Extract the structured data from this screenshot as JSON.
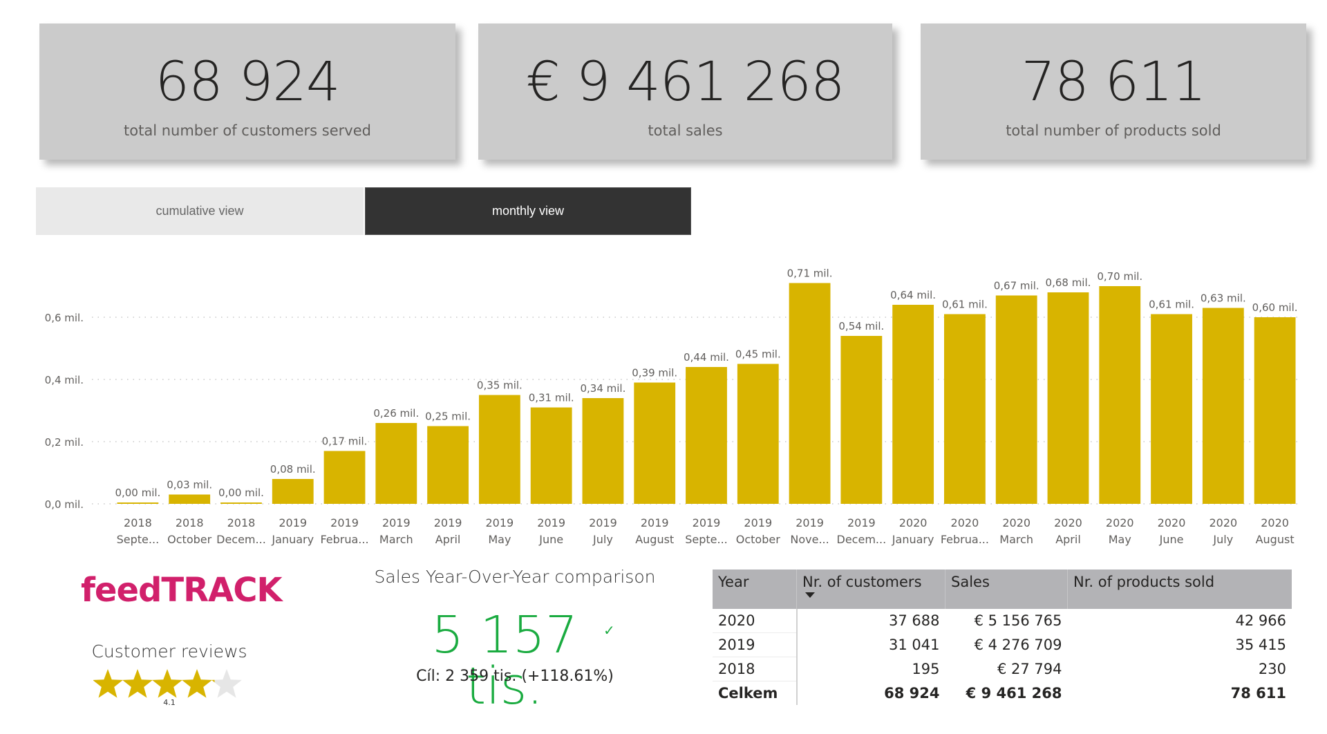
{
  "cards": [
    {
      "value": "68 924",
      "label": "total number of customers served"
    },
    {
      "value": "€ 9 461 268",
      "label": "total sales"
    },
    {
      "value": "78 611",
      "label": "total number of products sold"
    }
  ],
  "tabs": {
    "cumulative": "cumulative view",
    "monthly": "monthly view",
    "active": "monthly"
  },
  "colors": {
    "bar": "#d8b400",
    "kpi_green": "#1aab40",
    "logo": "#d1206b",
    "star_on": "#d8b400",
    "star_off": "#e6e6e6"
  },
  "chart_data": {
    "type": "bar",
    "title": "",
    "xlabel": "",
    "ylabel": "",
    "ylim": [
      0,
      0.75
    ],
    "yticks": [
      0,
      0.2,
      0.4,
      0.6
    ],
    "ytick_labels": [
      "0,0 mil.",
      "0,2 mil.",
      "0,4 mil.",
      "0,6 mil."
    ],
    "grid": true,
    "categories": [
      {
        "year": "2018",
        "month": "Septe..."
      },
      {
        "year": "2018",
        "month": "October"
      },
      {
        "year": "2018",
        "month": "Decem..."
      },
      {
        "year": "2019",
        "month": "January"
      },
      {
        "year": "2019",
        "month": "Februa..."
      },
      {
        "year": "2019",
        "month": "March"
      },
      {
        "year": "2019",
        "month": "April"
      },
      {
        "year": "2019",
        "month": "May"
      },
      {
        "year": "2019",
        "month": "June"
      },
      {
        "year": "2019",
        "month": "July"
      },
      {
        "year": "2019",
        "month": "August"
      },
      {
        "year": "2019",
        "month": "Septe..."
      },
      {
        "year": "2019",
        "month": "October"
      },
      {
        "year": "2019",
        "month": "Nove..."
      },
      {
        "year": "2019",
        "month": "Decem..."
      },
      {
        "year": "2020",
        "month": "January"
      },
      {
        "year": "2020",
        "month": "Februa..."
      },
      {
        "year": "2020",
        "month": "March"
      },
      {
        "year": "2020",
        "month": "April"
      },
      {
        "year": "2020",
        "month": "May"
      },
      {
        "year": "2020",
        "month": "June"
      },
      {
        "year": "2020",
        "month": "July"
      },
      {
        "year": "2020",
        "month": "August"
      }
    ],
    "values": [
      0.0,
      0.03,
      0.0,
      0.08,
      0.17,
      0.26,
      0.25,
      0.35,
      0.31,
      0.34,
      0.39,
      0.44,
      0.45,
      0.71,
      0.54,
      0.64,
      0.61,
      0.67,
      0.68,
      0.7,
      0.61,
      0.63,
      0.6
    ],
    "labels": [
      "0,00 mil.",
      "0,03 mil.",
      "0,00 mil.",
      "0,08 mil.",
      "0,17 mil.",
      "0,26 mil.",
      "0,25 mil.",
      "0,35 mil.",
      "0,31 mil.",
      "0,34 mil.",
      "0,39 mil.",
      "0,44 mil.",
      "0,45 mil.",
      "0,71 mil.",
      "0,54 mil.",
      "0,64 mil.",
      "0,61 mil.",
      "0,67 mil.",
      "0,68 mil.",
      "0,70 mil.",
      "0,61 mil.",
      "0,63 mil.",
      "0,60 mil."
    ]
  },
  "logo": "feedTRACK",
  "reviews": {
    "title": "Customer reviews",
    "rating": 4.1,
    "max": 5,
    "rating_label": "4.1"
  },
  "yoy": {
    "title": "Sales Year-Over-Year comparison",
    "value": "5 157 tis.",
    "status_icon": "check-icon",
    "target": "Cíl: 2 359 tis. (+118.61%)"
  },
  "table": {
    "headers": [
      "Year",
      "Nr. of customers",
      "Sales",
      "Nr. of products sold"
    ],
    "sort_column": "Nr. of customers",
    "sort_direction": "desc",
    "rows": [
      [
        "2020",
        "37 688",
        "€ 5 156 765",
        "42 966"
      ],
      [
        "2019",
        "31 041",
        "€ 4 276 709",
        "35 415"
      ],
      [
        "2018",
        "195",
        "€ 27 794",
        "230"
      ]
    ],
    "total": [
      "Celkem",
      "68 924",
      "€ 9 461 268",
      "78 611"
    ]
  }
}
